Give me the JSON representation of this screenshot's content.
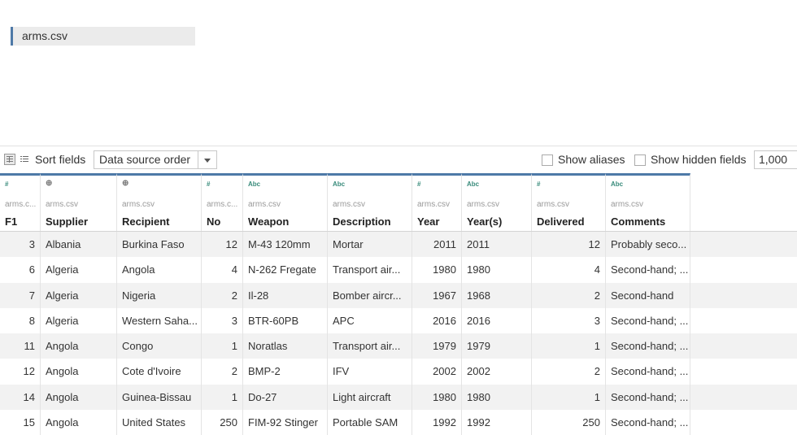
{
  "canvas": {
    "table_name": "arms.csv"
  },
  "toolbar": {
    "sort_label": "Sort fields",
    "sort_value": "Data source order",
    "show_aliases": "Show aliases",
    "show_hidden": "Show hidden fields",
    "rows": "1,000"
  },
  "columns": [
    {
      "type_icon": "#",
      "source": "arms.csv",
      "name": "F1"
    },
    {
      "type_icon": "globe",
      "source": "arms.csv",
      "name": "Supplier"
    },
    {
      "type_icon": "globe",
      "source": "arms.csv",
      "name": "Recipient"
    },
    {
      "type_icon": "#",
      "source": "arms.csv",
      "name": "No"
    },
    {
      "type_icon": "Abc",
      "source": "arms.csv",
      "name": "Weapon"
    },
    {
      "type_icon": "Abc",
      "source": "arms.csv",
      "name": "Description"
    },
    {
      "type_icon": "#",
      "source": "arms.csv",
      "name": "Year"
    },
    {
      "type_icon": "Abc",
      "source": "arms.csv",
      "name": "Year(s)"
    },
    {
      "type_icon": "#",
      "source": "arms.csv",
      "name": "Delivered"
    },
    {
      "type_icon": "Abc",
      "source": "arms.csv",
      "name": "Comments"
    }
  ],
  "rows": [
    [
      "3",
      "Albania",
      "Burkina Faso",
      "12",
      "M-43 120mm",
      "Mortar",
      "2011",
      "2011",
      "12",
      "Probably seco..."
    ],
    [
      "6",
      "Algeria",
      "Angola",
      "4",
      "N-262 Fregate",
      "Transport air...",
      "1980",
      "1980",
      "4",
      "Second-hand; ..."
    ],
    [
      "7",
      "Algeria",
      "Nigeria",
      "2",
      "Il-28",
      "Bomber aircr...",
      "1967",
      "1968",
      "2",
      "Second-hand"
    ],
    [
      "8",
      "Algeria",
      "Western Saha...",
      "3",
      "BTR-60PB",
      "APC",
      "2016",
      "2016",
      "3",
      "Second-hand; ..."
    ],
    [
      "11",
      "Angola",
      "Congo",
      "1",
      "Noratlas",
      "Transport air...",
      "1979",
      "1979",
      "1",
      "Second-hand; ..."
    ],
    [
      "12",
      "Angola",
      "Cote d'Ivoire",
      "2",
      "BMP-2",
      "IFV",
      "2002",
      "2002",
      "2",
      "Second-hand; ..."
    ],
    [
      "14",
      "Angola",
      "Guinea-Bissau",
      "1",
      "Do-27",
      "Light aircraft",
      "1980",
      "1980",
      "1",
      "Second-hand; ..."
    ],
    [
      "15",
      "Angola",
      "United States",
      "250",
      "FIM-92 Stinger",
      "Portable SAM",
      "1992",
      "1992",
      "250",
      "Second-hand; ..."
    ]
  ]
}
